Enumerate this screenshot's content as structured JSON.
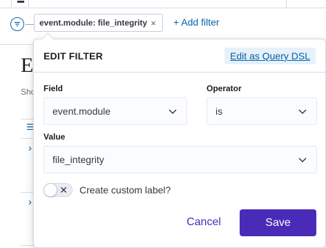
{
  "filter_bar": {
    "pill_label": "event.module: file_integrity",
    "pill_close": "×",
    "add_filter": "+ Add filter"
  },
  "background": {
    "title_fragment": "Ev",
    "subtitle_fragment": "Sho"
  },
  "popover": {
    "title": "EDIT FILTER",
    "query_dsl_link": "Edit as Query DSL",
    "field": {
      "label": "Field",
      "value": "event.module"
    },
    "operator": {
      "label": "Operator",
      "value": "is"
    },
    "value": {
      "label": "Value",
      "value": "file_integrity"
    },
    "custom_label": {
      "text": "Create custom label?",
      "enabled": false,
      "toggle_glyph": "✕"
    },
    "cancel_label": "Cancel",
    "save_label": "Save"
  },
  "colors": {
    "accent": "#4a2bb8",
    "link": "#0061a6",
    "link_highlight_bg": "#e6f1fa",
    "border": "#d3dae6"
  },
  "icons": [
    "filter-menu-icon",
    "close-icon",
    "chevron-down-icon",
    "list-icon",
    "chevron-right-icon",
    "cross-icon"
  ]
}
